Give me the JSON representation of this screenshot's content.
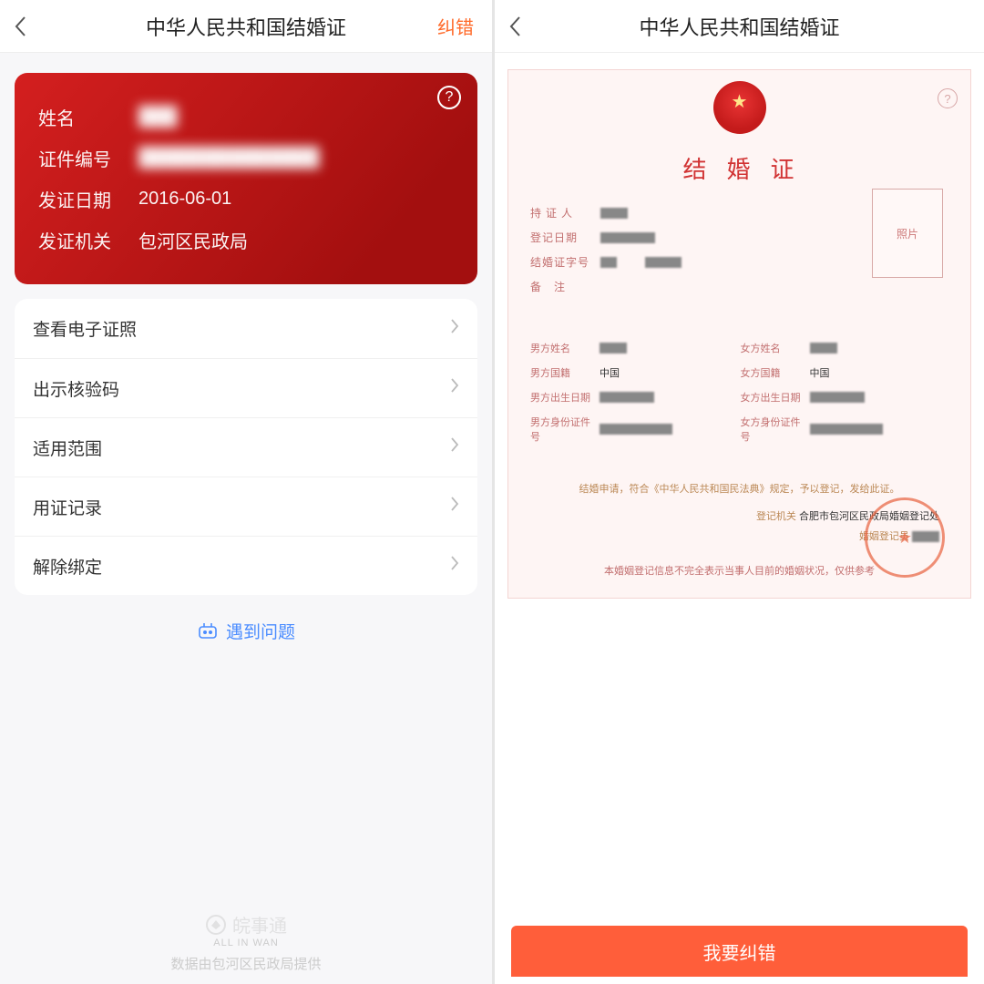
{
  "left": {
    "header": {
      "title": "中华人民共和国结婚证",
      "action": "纠错"
    },
    "card": {
      "rows": [
        {
          "label": "姓名",
          "value": "███",
          "blurred": true
        },
        {
          "label": "证件编号",
          "value": "██████████████",
          "blurred": true
        },
        {
          "label": "发证日期",
          "value": "2016-06-01",
          "blurred": false
        },
        {
          "label": "发证机关",
          "value": "包河区民政局",
          "blurred": false
        }
      ]
    },
    "menu": [
      "查看电子证照",
      "出示核验码",
      "适用范围",
      "用证记录",
      "解除绑定"
    ],
    "help_link": "遇到问题",
    "footer": {
      "brand": "皖事通",
      "brand_sub": "ALL IN WAN",
      "source": "数据由包河区民政局提供"
    }
  },
  "right": {
    "header": {
      "title": "中华人民共和国结婚证"
    },
    "cert": {
      "title": "结婚证",
      "top_fields": [
        {
          "label": "持证人"
        },
        {
          "label": "登记日期"
        },
        {
          "label": "结婚证字号"
        },
        {
          "label": "备注"
        }
      ],
      "photo_label": "照片",
      "male": {
        "name_label": "男方姓名",
        "nation_label": "男方国籍",
        "nation_value": "中国",
        "dob_label": "男方出生日期",
        "id_label": "男方身份证件号"
      },
      "female": {
        "name_label": "女方姓名",
        "nation_label": "女方国籍",
        "nation_value": "中国",
        "dob_label": "女方出生日期",
        "id_label": "女方身份证件号"
      },
      "declaration": "结婚申请，符合《中华人民共和国民法典》规定，予以登记，发给此证。",
      "reg_office_label": "登记机关",
      "reg_office_value": "合肥市包河区民政局婚姻登记处",
      "registrar_label": "婚姻登记员",
      "note": "本婚姻登记信息不完全表示当事人目前的婚姻状况，仅供参考"
    },
    "button": "我要纠错"
  }
}
